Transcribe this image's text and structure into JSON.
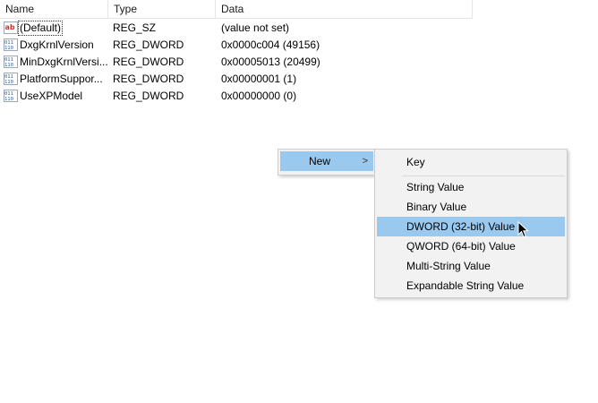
{
  "columns": {
    "name": "Name",
    "type": "Type",
    "data": "Data"
  },
  "rows": [
    {
      "name": "(Default)",
      "type": "REG_SZ",
      "data": "(value not set)",
      "icon": "string-value-icon"
    },
    {
      "name": "DxgKrnlVersion",
      "type": "REG_DWORD",
      "data": "0x0000c004 (49156)",
      "icon": "binary-value-icon"
    },
    {
      "name": "MinDxgKrnlVersi...",
      "type": "REG_DWORD",
      "data": "0x00005013 (20499)",
      "icon": "binary-value-icon"
    },
    {
      "name": "PlatformSuppor...",
      "type": "REG_DWORD",
      "data": "0x00000001 (1)",
      "icon": "binary-value-icon"
    },
    {
      "name": "UseXPModel",
      "type": "REG_DWORD",
      "data": "0x00000000 (0)",
      "icon": "binary-value-icon"
    }
  ],
  "context_menu": {
    "new_label": "New",
    "new_arrow": ">",
    "submenu": {
      "key": "Key",
      "string_value": "String Value",
      "binary_value": "Binary Value",
      "dword_value": "DWORD (32-bit) Value",
      "qword_value": "QWORD (64-bit) Value",
      "multi_string_value": "Multi-String Value",
      "expandable_string_value": "Expandable String Value"
    },
    "highlighted": "DWORD (32-bit) Value"
  },
  "colors": {
    "highlight": "#99c9ef",
    "menu_bg": "#f2f2f2",
    "menu_border": "#cccccc"
  }
}
